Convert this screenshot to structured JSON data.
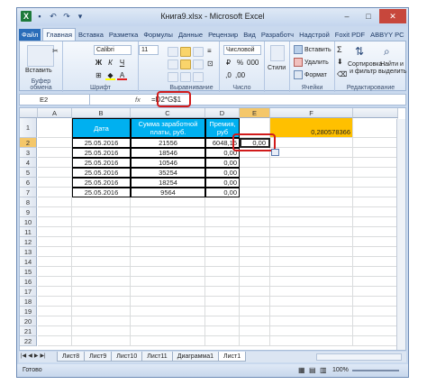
{
  "window": {
    "title": "Книга9.xlsx - Microsoft Excel",
    "qat_icons": [
      "excel-logo-icon",
      "save-icon",
      "undo-icon",
      "redo-icon",
      "customize-icon"
    ]
  },
  "tabs": [
    {
      "label": "Файл",
      "type": "file"
    },
    {
      "label": "Главная",
      "type": "active"
    },
    {
      "label": "Вставка",
      "type": ""
    },
    {
      "label": "Разметка",
      "type": ""
    },
    {
      "label": "Формулы",
      "type": ""
    },
    {
      "label": "Данные",
      "type": ""
    },
    {
      "label": "Рецензир",
      "type": ""
    },
    {
      "label": "Вид",
      "type": ""
    },
    {
      "label": "Разработч",
      "type": ""
    },
    {
      "label": "Надстрой",
      "type": ""
    },
    {
      "label": "Foxit PDF",
      "type": ""
    },
    {
      "label": "ABBYY PC",
      "type": ""
    }
  ],
  "ribbon": {
    "clipboard": {
      "paste": "Вставить",
      "label": "Буфер обмена"
    },
    "font": {
      "name": "Calibri",
      "size": "11",
      "label": "Шрифт"
    },
    "alignment": {
      "label": "Выравнивание"
    },
    "number": {
      "format": "Числовой",
      "label": "Число"
    },
    "styles": {
      "button": "Стили",
      "label": ""
    },
    "cells": {
      "insert": "Вставить",
      "delete": "Удалить",
      "format": "Формат",
      "label": "Ячейки"
    },
    "editing": {
      "sort": "Сортировка и фильтр",
      "find": "Найти и выделить",
      "label": "Редактирование"
    }
  },
  "formula_bar": {
    "name_box": "E2",
    "fx": "fx",
    "formula": "=D2*G$1"
  },
  "grid": {
    "columns": [
      "A",
      "B",
      "C",
      "D",
      "E",
      "F"
    ],
    "rows": [
      "1",
      "2",
      "3",
      "4",
      "5",
      "6",
      "7",
      "8",
      "9",
      "10",
      "11",
      "12",
      "13",
      "14",
      "15",
      "16",
      "17",
      "18",
      "19",
      "20",
      "21",
      "22"
    ],
    "header": {
      "date": "Дата",
      "salary": "Сумма заработной платы, руб.",
      "bonus": "Премия, руб"
    },
    "f1_value": "0,280578366",
    "data": [
      {
        "date": "25.05.2016",
        "salary": "21556",
        "bonus": "6048,15"
      },
      {
        "date": "25.05.2016",
        "salary": "18546",
        "bonus": "0,00"
      },
      {
        "date": "25.05.2016",
        "salary": "10546",
        "bonus": "0,00"
      },
      {
        "date": "25.05.2016",
        "salary": "35254",
        "bonus": "0,00"
      },
      {
        "date": "25.05.2016",
        "salary": "18254",
        "bonus": "0,00"
      },
      {
        "date": "25.05.2016",
        "salary": "9564",
        "bonus": "0,00"
      }
    ],
    "e2_value": "0,00"
  },
  "sheets": [
    "Лист8",
    "Лист9",
    "Лист10",
    "Лист11",
    "Диаграмма1",
    "Лист1"
  ],
  "active_sheet": "Лист1",
  "status": {
    "ready": "Готово",
    "zoom": "100%"
  }
}
